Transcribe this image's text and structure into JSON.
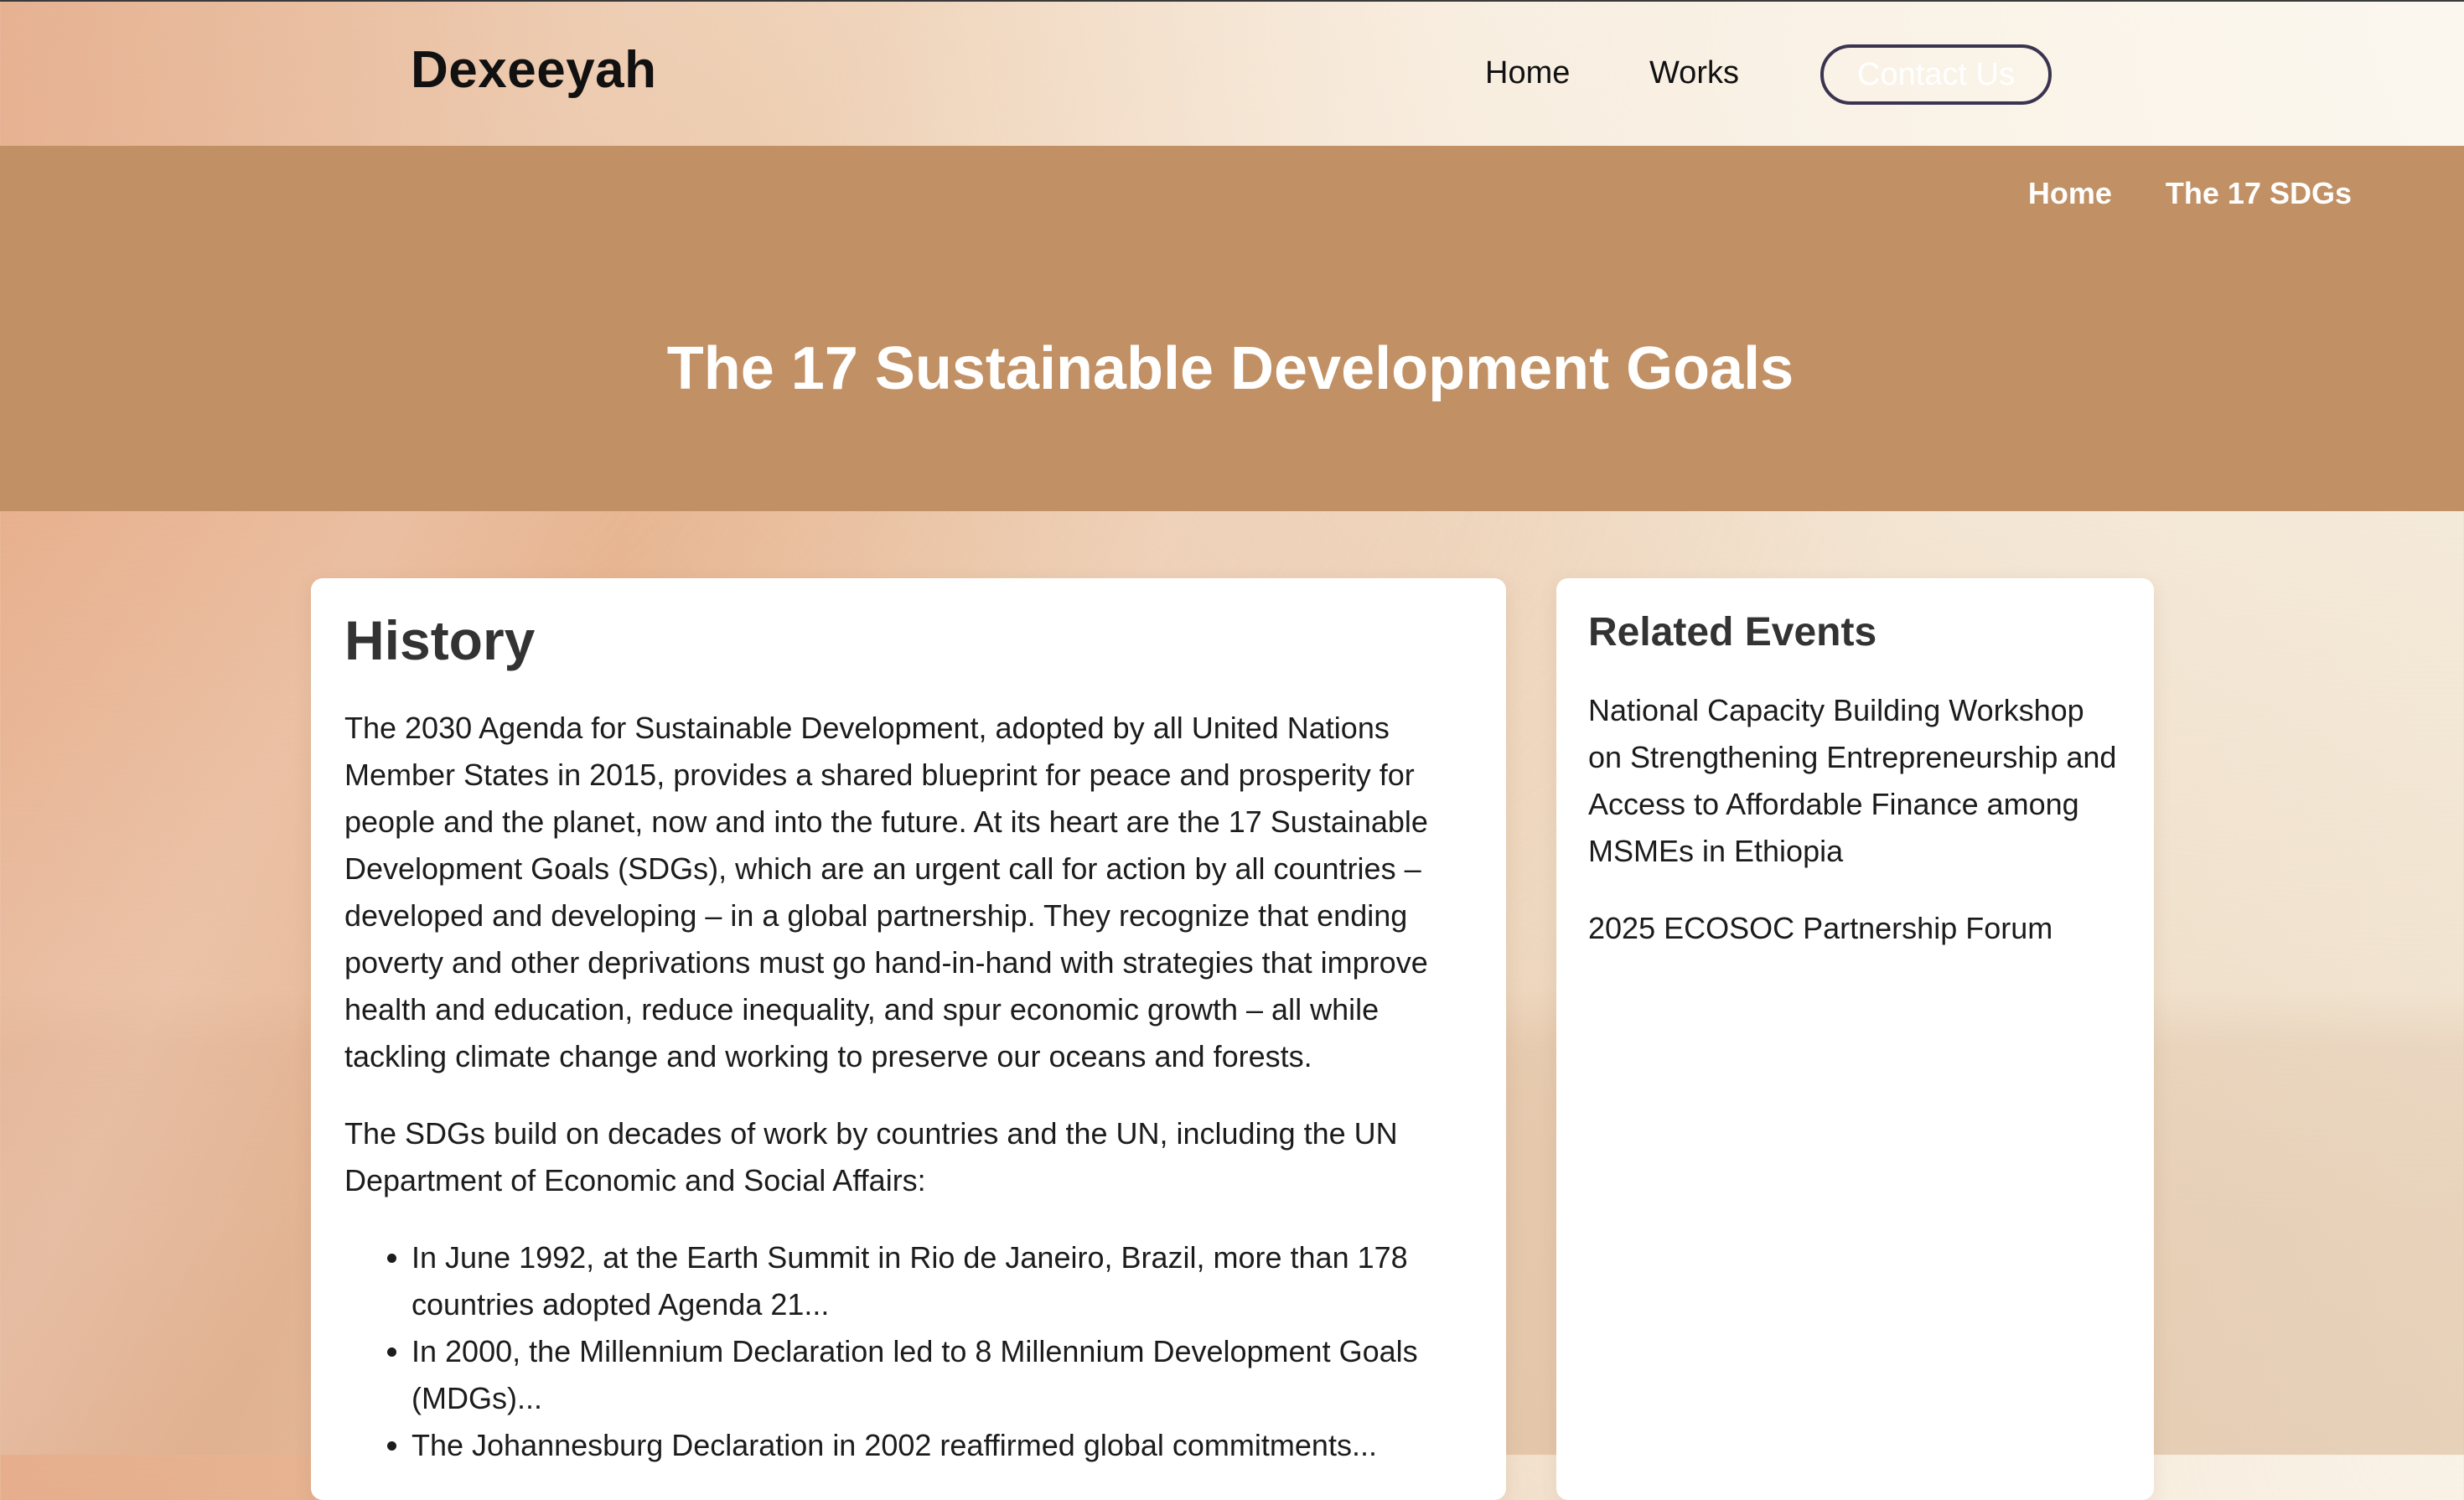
{
  "header": {
    "logo": "Dexeeyah",
    "nav": {
      "home": "Home",
      "works": "Works",
      "contact": "Contact Us"
    }
  },
  "hero": {
    "breadcrumb": [
      "Home",
      "The 17 SDGs"
    ],
    "title": "The 17 Sustainable Development Goals"
  },
  "history": {
    "title": "History",
    "paragraphs": [
      "The 2030 Agenda for Sustainable Development, adopted by all United Nations Member States in 2015, provides a shared blueprint for peace and prosperity for people and the planet, now and into the future. At its heart are the 17 Sustainable Development Goals (SDGs), which are an urgent call for action by all countries – developed and developing – in a global partnership. They recognize that ending poverty and other deprivations must go hand-in-hand with strategies that improve health and education, reduce inequality, and spur economic growth – all while tackling climate change and working to preserve our oceans and forests.",
      "The SDGs build on decades of work by countries and the UN, including the UN Department of Economic and Social Affairs:"
    ],
    "bullets": [
      "In June 1992, at the Earth Summit in Rio de Janeiro, Brazil, more than 178 countries adopted Agenda 21...",
      "In 2000, the Millennium Declaration led to 8 Millennium Development Goals (MDGs)...",
      "The Johannesburg Declaration in 2002 reaffirmed global commitments..."
    ]
  },
  "events": {
    "title": "Related Events",
    "items": [
      "National Capacity Building Workshop on Strengthening Entrepreneurship and Access to Affordable Finance among MSMEs in Ethiopia",
      "2025 ECOSOC Partnership Forum"
    ]
  },
  "colors": {
    "hero_band": "#c19165",
    "card_bg": "#ffffff",
    "contact_border": "#3b3450"
  }
}
